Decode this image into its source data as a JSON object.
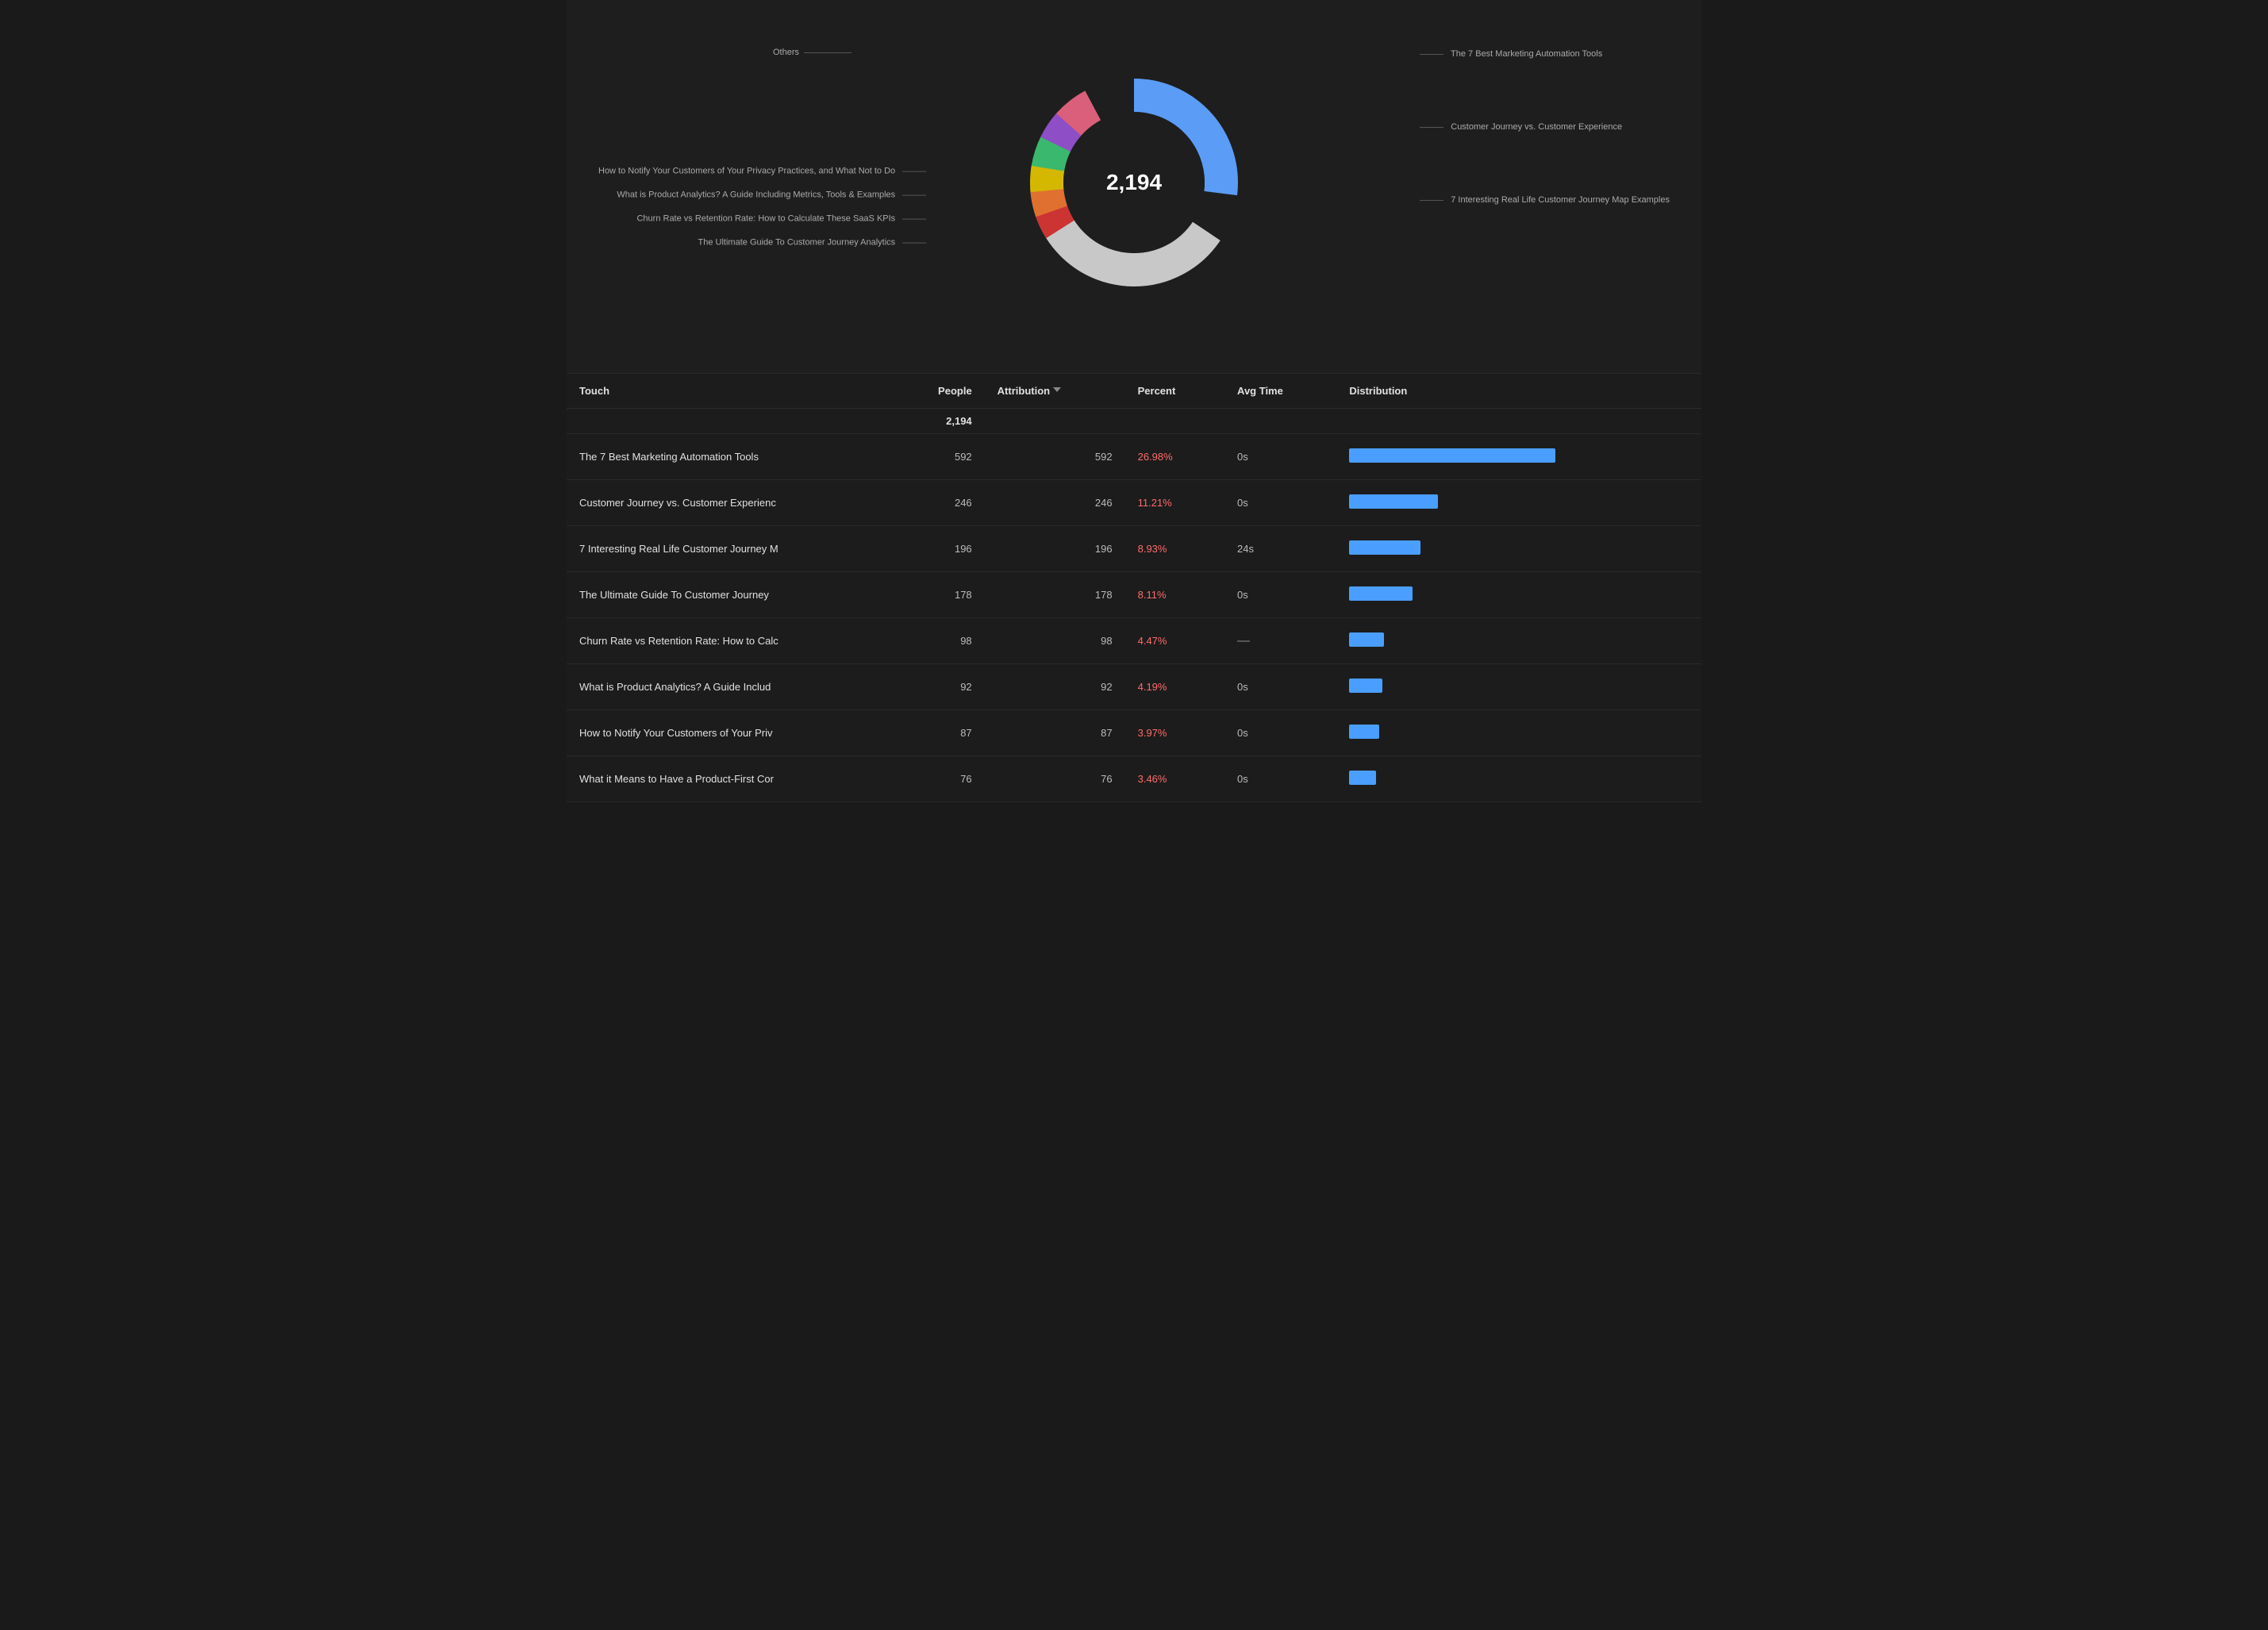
{
  "chart": {
    "center_value": "2,194",
    "others_label": "Others",
    "left_labels": [
      "How to Notify Your Customers of Your Privacy Practices, and What Not to Do",
      "What is Product Analytics? A Guide Including Metrics, Tools & Examples",
      "Churn Rate vs Retention Rate: How to Calculate These SaaS KPIs",
      "The Ultimate Guide To Customer Journey Analytics"
    ],
    "right_labels": [
      "The 7 Best Marketing Automation Tools",
      "Customer Journey vs. Customer Experience",
      "7 Interesting Real Life Customer Journey Map Examples"
    ],
    "segments": [
      {
        "name": "automation_tools",
        "color": "#5b9cf6",
        "percent": 27,
        "start_deg": 0,
        "end_deg": 97
      },
      {
        "name": "others_gray",
        "color": "#c0c0c0",
        "percent": 40,
        "start_deg": 97,
        "end_deg": 240
      },
      {
        "name": "privacy",
        "color": "#e05555",
        "percent": 4,
        "start_deg": 240,
        "end_deg": 254
      },
      {
        "name": "product_analytics",
        "color": "#e88c3c",
        "percent": 4.2,
        "start_deg": 254,
        "end_deg": 269
      },
      {
        "name": "churn_rate",
        "color": "#f0d040",
        "percent": 4.5,
        "start_deg": 269,
        "end_deg": 285
      },
      {
        "name": "customer_journey_guide",
        "color": "#50c878",
        "percent": 5,
        "start_deg": 285,
        "end_deg": 303
      },
      {
        "name": "real_life",
        "color": "#9b59b6",
        "percent": 5,
        "start_deg": 303,
        "end_deg": 320
      },
      {
        "name": "customer_journey_exp",
        "color": "#e05555",
        "percent": 8,
        "start_deg": 320,
        "end_deg": 349
      },
      {
        "name": "customer_journey_vs",
        "color": "#e05555",
        "percent": 11,
        "start_deg": 349,
        "end_deg": 360
      }
    ]
  },
  "table": {
    "columns": [
      {
        "key": "touch",
        "label": "Touch"
      },
      {
        "key": "people",
        "label": "People"
      },
      {
        "key": "attribution",
        "label": "Attribution",
        "sortable": true
      },
      {
        "key": "percent",
        "label": "Percent"
      },
      {
        "key": "avg_time",
        "label": "Avg Time"
      },
      {
        "key": "distribution",
        "label": "Distribution"
      }
    ],
    "total_attribution": "2,194",
    "rows": [
      {
        "touch": "The 7 Best Marketing Automation Tools",
        "people": "592",
        "attribution": "592",
        "percent": "26.98%",
        "avg_time": "0s",
        "dist_width": 260
      },
      {
        "touch": "Customer Journey vs. Customer Experienc",
        "people": "246",
        "attribution": "246",
        "percent": "11.21%",
        "avg_time": "0s",
        "dist_width": 112
      },
      {
        "touch": "7 Interesting Real Life Customer Journey M",
        "people": "196",
        "attribution": "196",
        "percent": "8.93%",
        "avg_time": "24s",
        "dist_width": 90
      },
      {
        "touch": "The Ultimate Guide To Customer Journey",
        "people": "178",
        "attribution": "178",
        "percent": "8.11%",
        "avg_time": "0s",
        "dist_width": 80
      },
      {
        "touch": "Churn Rate vs Retention Rate: How to Calc",
        "people": "98",
        "attribution": "98",
        "percent": "4.47%",
        "avg_time": "—",
        "dist_width": 44,
        "avg_is_dash": true
      },
      {
        "touch": "What is Product Analytics? A Guide Includ",
        "people": "92",
        "attribution": "92",
        "percent": "4.19%",
        "avg_time": "0s",
        "dist_width": 42
      },
      {
        "touch": "How to Notify Your Customers of Your Priv",
        "people": "87",
        "attribution": "87",
        "percent": "3.97%",
        "avg_time": "0s",
        "dist_width": 38
      },
      {
        "touch": "What it Means to Have a Product-First Cor",
        "people": "76",
        "attribution": "76",
        "percent": "3.46%",
        "avg_time": "0s",
        "dist_width": 34
      }
    ]
  }
}
